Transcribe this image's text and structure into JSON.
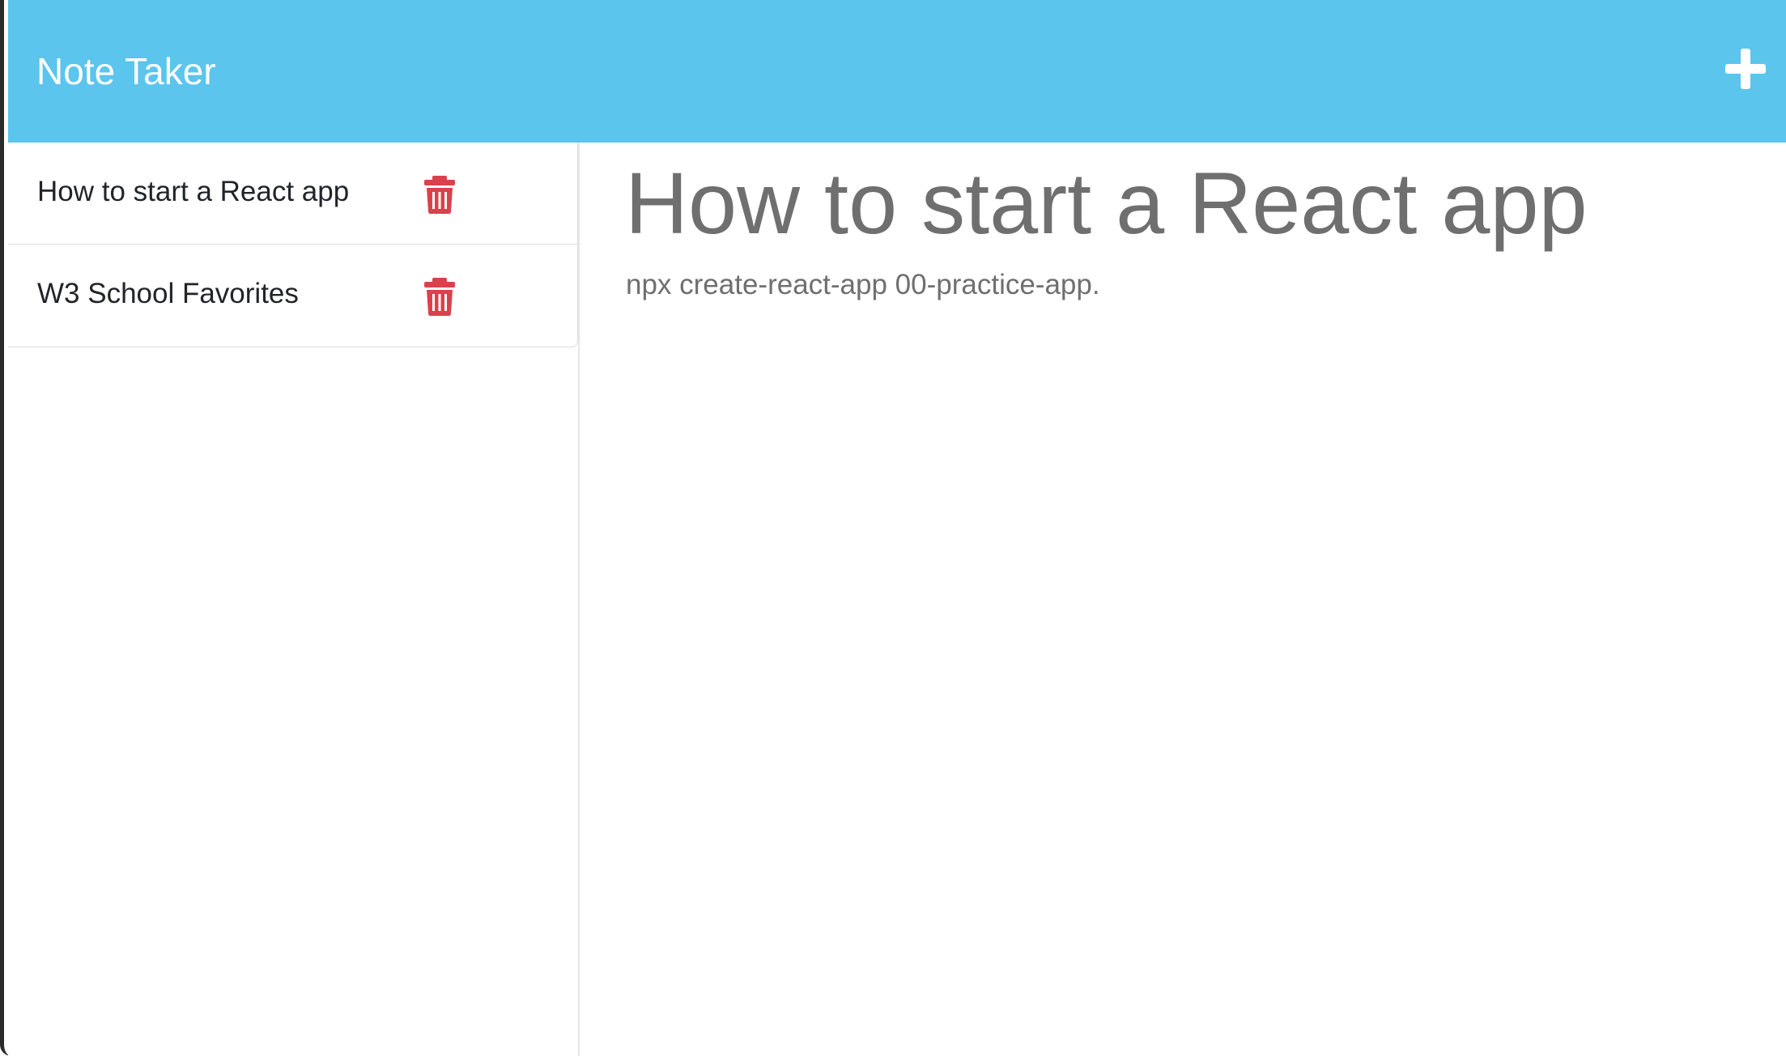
{
  "navbar": {
    "brand": "Note Taker",
    "background_color": "#5bc5ed",
    "new_note_icon": "plus-icon"
  },
  "sidebar": {
    "notes": [
      {
        "title": "How to start a React app",
        "delete_icon": "trash-icon"
      },
      {
        "title": "W3 School Favorites",
        "delete_icon": "trash-icon"
      }
    ],
    "delete_icon_color": "#d9424c"
  },
  "main": {
    "note_title": "How to start a React app",
    "note_text": "npx create-react-app 00-practice-app."
  }
}
